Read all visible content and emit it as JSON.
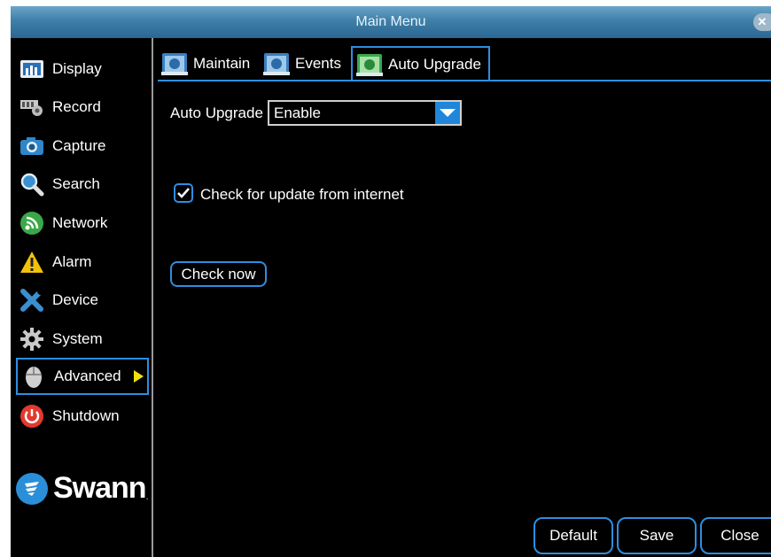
{
  "window": {
    "title": "Main Menu",
    "close_glyph": "✕"
  },
  "sidebar": {
    "items": [
      {
        "label": "Display",
        "icon": "display-icon"
      },
      {
        "label": "Record",
        "icon": "record-icon"
      },
      {
        "label": "Capture",
        "icon": "camera-icon"
      },
      {
        "label": "Search",
        "icon": "search-icon"
      },
      {
        "label": "Network",
        "icon": "network-icon"
      },
      {
        "label": "Alarm",
        "icon": "warning-icon"
      },
      {
        "label": "Device",
        "icon": "wrench-icon"
      },
      {
        "label": "System",
        "icon": "gear-icon"
      },
      {
        "label": "Advanced",
        "icon": "mouse-icon",
        "selected": true
      },
      {
        "label": "Shutdown",
        "icon": "power-icon"
      }
    ],
    "logo": {
      "text": "Swann",
      "mark": "."
    }
  },
  "tabs": [
    {
      "label": "Maintain",
      "icon": "monitor-icon"
    },
    {
      "label": "Events",
      "icon": "monitor-icon"
    },
    {
      "label": "Auto Upgrade",
      "icon": "monitor-icon",
      "selected": true
    }
  ],
  "auto_upgrade": {
    "label": "Auto Upgrade",
    "value": "Enable"
  },
  "check_internet": {
    "label": "Check for update from internet",
    "checked": true
  },
  "check_now_label": "Check now",
  "footer": {
    "default_label": "Default",
    "save_label": "Save",
    "close_label": "Close"
  },
  "colors": {
    "accent": "#2e8ee0",
    "titlebar": "#3f7fa8",
    "selection_arrow": "#f2e20a",
    "background": "#000000"
  }
}
